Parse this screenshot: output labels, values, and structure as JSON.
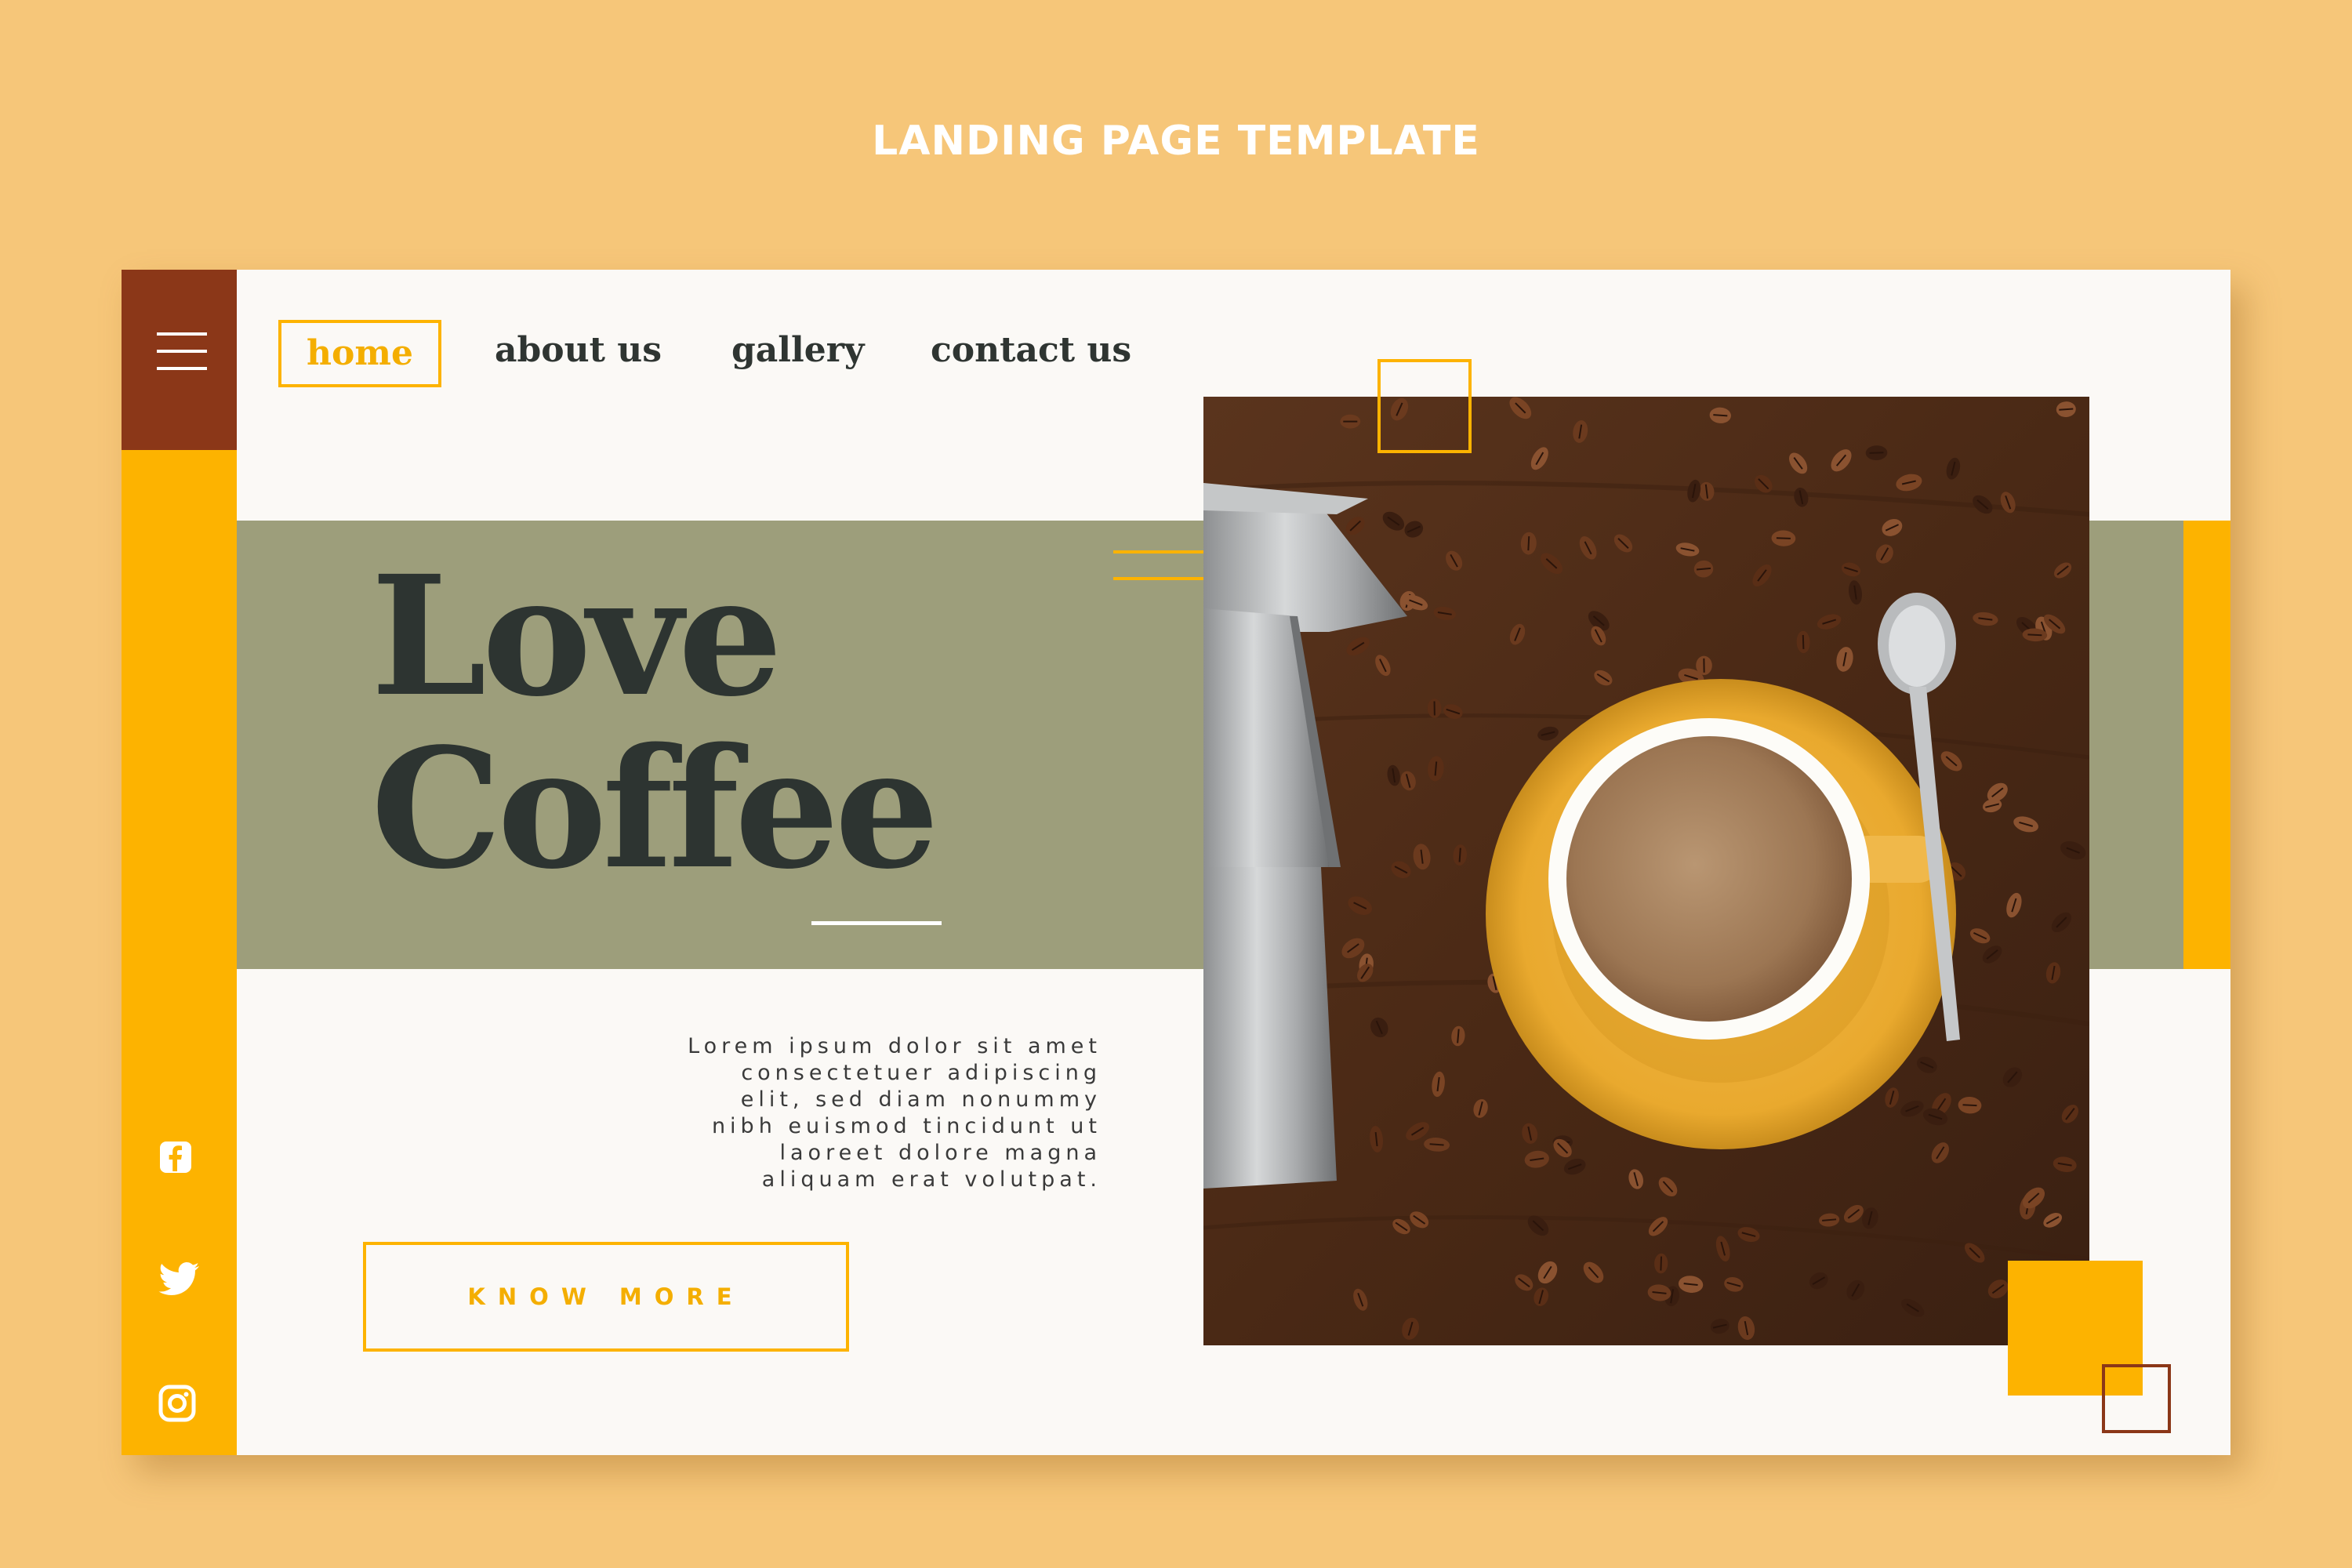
{
  "page": {
    "heading": "LANDING PAGE TEMPLATE"
  },
  "nav": {
    "items": [
      {
        "label": "home",
        "active": true
      },
      {
        "label": "about us",
        "active": false
      },
      {
        "label": "gallery",
        "active": false
      },
      {
        "label": "contact us",
        "active": false
      }
    ]
  },
  "hero": {
    "title_line1": "Love",
    "title_line2": "Coffee",
    "body": "Lorem ipsum dolor sit amet\nconsectetuer adipiscing\nelit, sed diam nonummy\nnibh euismod tincidunt ut\nlaoreet dolore magna\naliquam erat volutpat.",
    "cta_label": "KNOW MORE"
  },
  "sidebar": {
    "menu_icon": "hamburger-menu-icon",
    "social": [
      "facebook-icon",
      "twitter-icon",
      "instagram-icon"
    ]
  },
  "colors": {
    "background": "#f6c679",
    "accent_yellow": "#fdb300",
    "accent_brown": "#8b3718",
    "olive_band": "#9d9e7b",
    "dark_text": "#2d3431",
    "card": "#fbf9f6"
  }
}
